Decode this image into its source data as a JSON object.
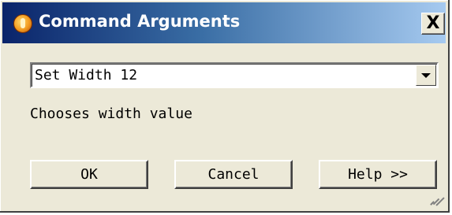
{
  "window": {
    "title": "Command Arguments",
    "close_label": "X"
  },
  "command_combo": {
    "selected_value": "Set Width 12"
  },
  "description": "Chooses width value",
  "buttons": {
    "ok": "OK",
    "cancel": "Cancel",
    "help": "Help >>"
  },
  "colors": {
    "titlebar_start": "#0a246a",
    "titlebar_end": "#a6caf0",
    "window_bg": "#ece9d8"
  }
}
